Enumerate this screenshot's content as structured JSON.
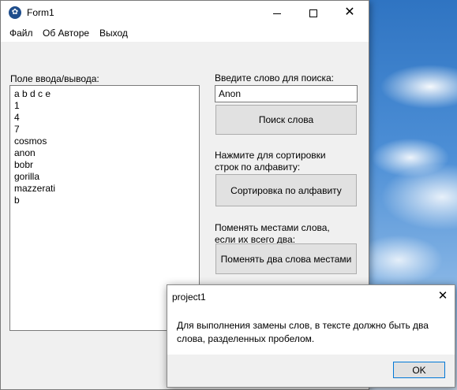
{
  "window": {
    "title": "Form1",
    "app_icon": "paw-icon",
    "minimize_icon": "minimize-icon",
    "maximize_icon": "maximize-icon",
    "close_glyph": "✕"
  },
  "menu": {
    "items": [
      "Файл",
      "Об Авторе",
      "Выход"
    ]
  },
  "io": {
    "label": "Поле ввода/вывода:",
    "lines": [
      "a b d c e",
      "1",
      "4",
      "7",
      "cosmos",
      "anon",
      "bobr",
      "gorilla",
      "mazzerati",
      "b"
    ]
  },
  "search": {
    "label": "Введите слово для поиска:",
    "value": "Anon",
    "button": "Поиск слова"
  },
  "sort": {
    "label_line1": "Нажмите для сортировки",
    "label_line2": "строк по алфавиту:",
    "button": "Сортировка по алфавиту"
  },
  "swap": {
    "label_line1": "Поменять местами слова,",
    "label_line2": "если их всего два:",
    "button": "Поменять два слова местами"
  },
  "dialog": {
    "title": "project1",
    "close_glyph": "✕",
    "message_line1": "Для выполнения замены слов, в тексте должно быть два",
    "message_line2": "слова, разделенных пробелом.",
    "ok": "OK"
  }
}
